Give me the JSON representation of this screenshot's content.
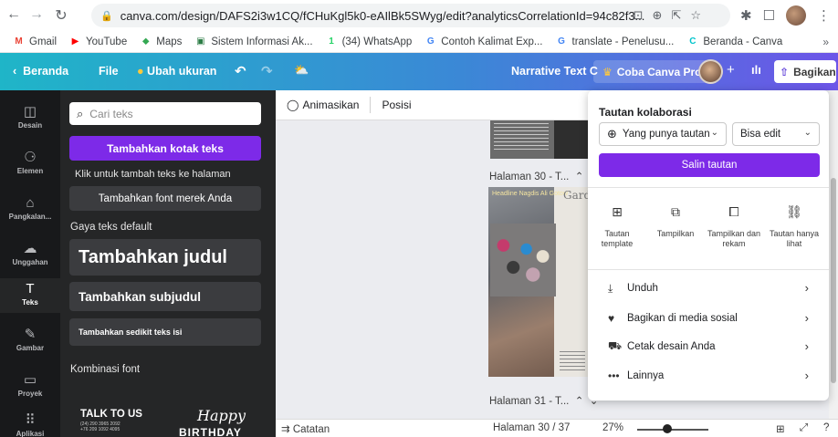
{
  "browser": {
    "url": "canva.com/design/DAFS2i3w1CQ/fCHuKgl5k0-eAIlBk5SWyg/edit?analyticsCorrelationId=94c82f3...",
    "bookmarks": [
      {
        "label": "Gmail",
        "icon": "gmail-icon",
        "icon_glyph": "M",
        "color": "#ea4335"
      },
      {
        "label": "YouTube",
        "icon": "youtube-icon",
        "icon_glyph": "▶",
        "color": "#ff0000"
      },
      {
        "label": "Maps",
        "icon": "maps-icon",
        "icon_glyph": "⬥",
        "color": "#34a853"
      },
      {
        "label": "Sistem Informasi Ak...",
        "icon": "university-icon",
        "icon_glyph": "▣",
        "color": "#2d7d46"
      },
      {
        "label": "(34) WhatsApp",
        "icon": "whatsapp-icon",
        "icon_glyph": "1",
        "color": "#25d366"
      },
      {
        "label": "Contoh Kalimat Exp...",
        "icon": "google-icon",
        "icon_glyph": "G",
        "color": "#4285f4"
      },
      {
        "label": "translate - Penelusu...",
        "icon": "google-icon",
        "icon_glyph": "G",
        "color": "#4285f4"
      },
      {
        "label": "Beranda - Canva",
        "icon": "canva-icon",
        "icon_glyph": "C",
        "color": "#00c4cc"
      }
    ],
    "bookmarks_more": "»"
  },
  "topbar": {
    "home": "Beranda",
    "file": "File",
    "resize": "Ubah ukuran",
    "doc_title": "Narrative Text C",
    "try_pro": "Coba Canva Pro",
    "share": "Bagikan",
    "add": "+"
  },
  "rail": [
    {
      "label": "Desain",
      "icon": "layout-icon",
      "glyph": "◫"
    },
    {
      "label": "Elemen",
      "icon": "elements-icon",
      "glyph": "⚆"
    },
    {
      "label": "Pangkalan...",
      "icon": "brand-kit-icon",
      "glyph": "⌂"
    },
    {
      "label": "Unggahan",
      "icon": "upload-icon",
      "glyph": "☁"
    },
    {
      "label": "Teks",
      "icon": "text-icon",
      "glyph": "T"
    },
    {
      "label": "Gambar",
      "icon": "draw-icon",
      "glyph": "✎"
    },
    {
      "label": "Proyek",
      "icon": "folder-icon",
      "glyph": "▭"
    },
    {
      "label": "Aplikasi",
      "icon": "apps-icon",
      "glyph": "⠿"
    }
  ],
  "panel": {
    "search_placeholder": "Cari teks",
    "add_textbox": "Tambahkan kotak teks",
    "click_hint": "Klik untuk tambah teks ke halaman",
    "add_brand_font": "Tambahkan font merek Anda",
    "default_styles": "Gaya teks default",
    "add_heading": "Tambahkan judul",
    "add_subheading": "Tambahkan subjudul",
    "add_body": "Tambahkan sedikit teks isi",
    "combos": "Kombinasi font",
    "combo1_title": "TALK TO US",
    "combo1_line1": "(24) 290 3965 2092",
    "combo1_line2": "+76 209 1092 4095",
    "combo2_title": "Happy",
    "combo2_sub": "BIRTHDAY"
  },
  "canvas": {
    "animate": "Animasikan",
    "position": "Posisi",
    "page30": "Halaman 30 - T...",
    "page31": "Halaman 31 - T...",
    "page_text_overlay": "Headline Nagdis Ali Gotow",
    "page_text_garden": "Gard"
  },
  "bottombar": {
    "notes": "Catatan",
    "page_indicator": "Halaman 30 / 37",
    "zoom": "27%",
    "zoom_level": 0.42
  },
  "share_popup": {
    "title": "Tautan kolaborasi",
    "access": "Yang punya tautan",
    "permission": "Bisa edit",
    "copy_link": "Salin tautan",
    "options": [
      {
        "label": "Tautan template",
        "icon": "template-link-icon",
        "glyph": "⊞"
      },
      {
        "label": "Tampilkan",
        "icon": "present-icon",
        "glyph": "⧉"
      },
      {
        "label": "Tampilkan dan rekam",
        "icon": "record-icon",
        "glyph": "⧠"
      },
      {
        "label": "Tautan hanya lihat",
        "icon": "link-icon",
        "glyph": "⛓"
      }
    ],
    "rows": [
      {
        "label": "Unduh",
        "icon": "download-icon",
        "glyph": "⤓"
      },
      {
        "label": "Bagikan di media sosial",
        "icon": "heart-icon",
        "glyph": "♥"
      },
      {
        "label": "Cetak desain Anda",
        "icon": "truck-icon",
        "glyph": "⛟"
      },
      {
        "label": "Lainnya",
        "icon": "more-icon",
        "glyph": "•••"
      }
    ]
  },
  "colors": {
    "accent": "#7d2ae8",
    "panel_bg": "#252627",
    "rail_bg": "#18191b"
  }
}
